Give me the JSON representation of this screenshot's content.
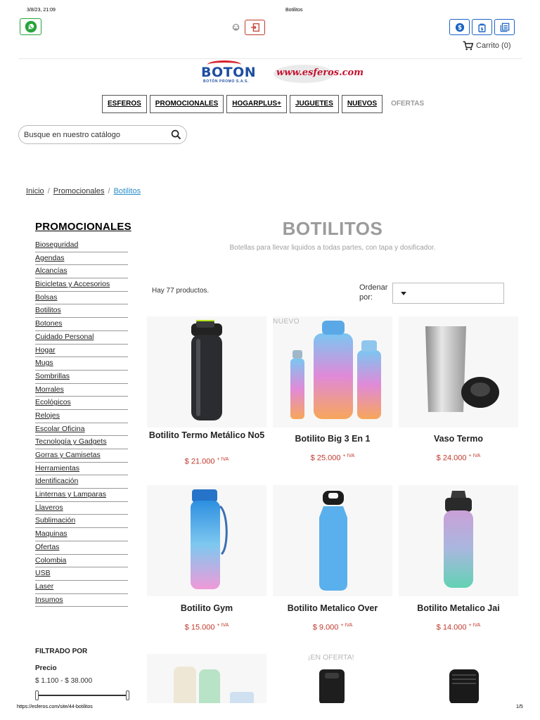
{
  "print": {
    "date": "3/8/23, 21:09",
    "title": "Botilitos",
    "url": "https://esferos.com/site/44-botilitos",
    "page": "1/5"
  },
  "header": {
    "cart_label": "Carrito (0)",
    "logo_boton_word": "BOTON",
    "logo_boton_sub": "BOTÓN PROMO S.A.S.",
    "logo_esferos_word": "www.esferos.com"
  },
  "nav": [
    {
      "label": "ESFEROS"
    },
    {
      "label": "PROMOCIONALES"
    },
    {
      "label": "HOGARPLUS+"
    },
    {
      "label": "JUGUETES"
    },
    {
      "label": "NUEVOS"
    },
    {
      "label": "OFERTAS"
    }
  ],
  "search": {
    "placeholder": "Busque en nuestro catálogo"
  },
  "breadcrumb": {
    "home": "Inicio",
    "parent": "Promocionales",
    "current": "Botilitos",
    "separator": "/"
  },
  "sidebar": {
    "title": "PROMOCIONALES",
    "items": [
      "Bioseguridad",
      "Agendas",
      "Alcancías",
      "Bicicletas y Accesorios",
      "Bolsas",
      "Botilitos",
      "Botones",
      "Cuidado Personal",
      "Hogar",
      "Mugs",
      "Sombrillas",
      "Morrales",
      "Ecológicos",
      "Relojes",
      "Escolar Oficina",
      "Tecnología y Gadgets",
      "Gorras y Camisetas",
      "Herramientas",
      "Identificación",
      "Linternas y Lamparas",
      "Llaveros",
      "Sublimación",
      "Maquinas",
      "Ofertas",
      "Colombia",
      "USB",
      "Laser",
      "Insumos"
    ]
  },
  "filters": {
    "title": "FILTRADO POR",
    "price_label": "Precio",
    "price_range": "$ 1.100 - $ 38.000"
  },
  "category": {
    "heading": "BOTILITOS",
    "description": "Botellas para llevar liquidos a todas partes, con tapa y dosificador."
  },
  "listing": {
    "count": "Hay 77 productos.",
    "sort_label": "Ordenar por:"
  },
  "products": [
    {
      "name": "Botilito Termo Metálico No5",
      "price": "$ 21.000",
      "tax": "+ IVA",
      "flag": ""
    },
    {
      "name": "Botilito Big 3 En 1",
      "price": "$ 25.000",
      "tax": "+ IVA",
      "flag": "NUEVO"
    },
    {
      "name": "Vaso Termo",
      "price": "$ 24.000",
      "tax": "+ IVA",
      "flag": ""
    },
    {
      "name": "Botilito Gym",
      "price": "$ 15.000",
      "tax": "+ IVA",
      "flag": ""
    },
    {
      "name": "Botilito Metalico Over",
      "price": "$ 9.000",
      "tax": "+ IVA",
      "flag": ""
    },
    {
      "name": "Botilito Metalico Jai",
      "price": "$ 14.000",
      "tax": "+ IVA",
      "flag": ""
    }
  ],
  "promo_flag": "¡EN OFERTA!",
  "colors": {
    "whatsapp": "#26a43a",
    "login": "#c0392b",
    "toolbar": "#1b63c6",
    "price": "#c0392b",
    "breadcrumb_current": "#2a8dc9",
    "heading_gray": "#9b9b9b"
  },
  "icons": [
    "whatsapp-icon",
    "smile-icon",
    "login-icon",
    "dollar-icon",
    "bag-icon",
    "catalog-icon",
    "cart-icon",
    "search-icon",
    "caret-down-icon"
  ]
}
